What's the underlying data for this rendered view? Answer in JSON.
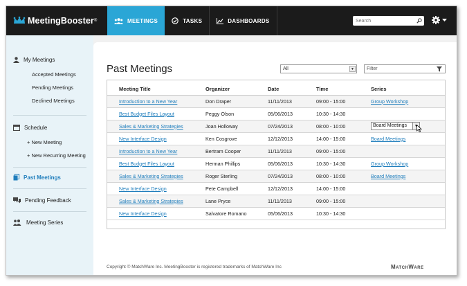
{
  "app": {
    "brand_name": "MeetingBooster",
    "brand_mark": "®",
    "accent_color": "#2aa6d6",
    "topbar_color": "#1b1b1b"
  },
  "nav": {
    "tabs": [
      {
        "label": "MEETINGS",
        "icon": "people-icon",
        "active": true
      },
      {
        "label": "TASKS",
        "icon": "check-circle-icon",
        "active": false
      },
      {
        "label": "DASHBOARDS",
        "icon": "line-chart-icon",
        "active": false
      }
    ],
    "search_placeholder": "Search",
    "settings_icon": "gear-icon"
  },
  "sidebar": {
    "my_meetings": {
      "label": "My Meetings",
      "icon": "person-icon",
      "items": [
        "Accepted Meetings",
        "Pending Meetings",
        "Declined Meetings"
      ]
    },
    "schedule": {
      "label": "Schedule",
      "icon": "calendar-icon",
      "items": [
        "+ New Meeting",
        "+ New Recurring Meeting"
      ]
    },
    "past_meetings": {
      "label": "Past Meetings",
      "icon": "copy-icon",
      "active": true
    },
    "pending_feedback": {
      "label": "Pending Feedback",
      "icon": "chat-bubbles-icon"
    },
    "meeting_series": {
      "label": "Meeting Series",
      "icon": "group-icon"
    }
  },
  "main": {
    "title": "Past Meetings",
    "scope_select": {
      "value": "All"
    },
    "filter": {
      "placeholder": "Filter"
    },
    "table": {
      "columns": [
        "Meeting Title",
        "Organizer",
        "Date",
        "Time",
        "Series"
      ],
      "rows": [
        {
          "title": "Introduction to a New Year",
          "organizer": "Don Draper",
          "date": "11/11/2013",
          "time": "09:00 - 15:00",
          "series": "Group Workshop"
        },
        {
          "title": "Best Budget Files Layout",
          "organizer": "Peggy Olson",
          "date": "05/06/2013",
          "time": "10:30 - 14:30",
          "series": ""
        },
        {
          "title": "Sales & Marketing Strategies",
          "organizer": "Joan Holloway",
          "date": "07/24/2013",
          "time": "08:00 - 10:00",
          "series": "Board Meetings"
        },
        {
          "title": "New Interface Design",
          "organizer": "Ken Cosgrove",
          "date": "12/12/2013",
          "time": "14:00 - 15:00",
          "series": "Board Meetings"
        },
        {
          "title": "Introduction to a New Year",
          "organizer": "Bertram Cooper",
          "date": "11/11/2013",
          "time": "09:00 - 15:00",
          "series": ""
        },
        {
          "title": "Best Budget Files Layout",
          "organizer": "Herman Phillips",
          "date": "05/06/2013",
          "time": "10:30 - 14:30",
          "series": "Group Workshop"
        },
        {
          "title": "Sales & Marketing Strategies",
          "organizer": "Roger Sterling",
          "date": "07/24/2013",
          "time": "08:00 - 10:00",
          "series": "Board Meetings"
        },
        {
          "title": "New Interface Design",
          "organizer": "Pete Campbell",
          "date": "12/12/2013",
          "time": "14:00 - 15:00",
          "series": ""
        },
        {
          "title": "Sales & Marketing Strategies",
          "organizer": "Lane Pryce",
          "date": "11/11/2013",
          "time": "09:00 - 15:00",
          "series": ""
        },
        {
          "title": "New Interface Design",
          "organizer": "Salvatore Romano",
          "date": "05/06/2013",
          "time": "10:30 - 14:30",
          "series": ""
        }
      ],
      "editing_row_index": 2
    }
  },
  "footer": {
    "copyright": "Copyright © MatchWare Inc.  MeetingBooster is registered trademarks of MatchWare Inc",
    "brand": "MatchWare"
  }
}
